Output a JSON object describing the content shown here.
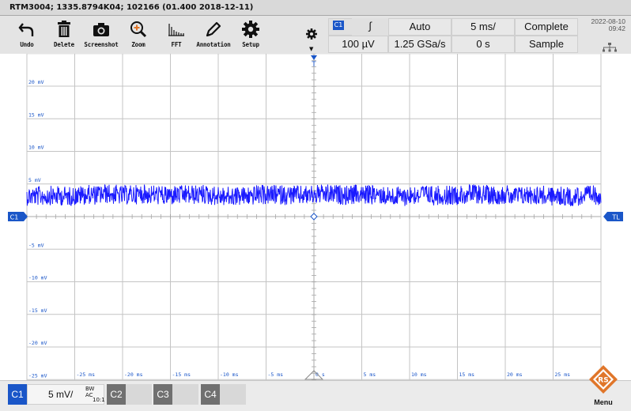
{
  "title": "RTM3004; 1335.8794K04; 102166 (01.400 2018-12-11)",
  "toolbar": {
    "undo": "Undo",
    "delete": "Delete",
    "screenshot": "Screenshot",
    "zoom": "Zoom",
    "fft": "FFT",
    "annotation": "Annotation",
    "setup": "Setup"
  },
  "status": {
    "channel": "C1",
    "slope": "∫",
    "trigger_mode": "Auto",
    "time_scale": "5 ms/",
    "acquisition_state": "Complete",
    "trigger_level": "100 µV",
    "sample_rate": "1.25 GSa/s",
    "trigger_offset": "0 s",
    "acquisition_mode": "Sample",
    "date": "2022-08-10",
    "time": "09:42"
  },
  "markers": {
    "channel_left": "C1",
    "trigger_right": "TL",
    "trigger_top": "T"
  },
  "axes": {
    "y_labels": [
      "20 mV",
      "15 mV",
      "10 mV",
      "5 mV",
      "-5 mV",
      "-10 mV",
      "-15 mV",
      "-20 mV",
      "-25 mV"
    ],
    "x_labels": [
      "-25 ms",
      "-20 ms",
      "-15 ms",
      "-10 ms",
      "-5 ms",
      "0 s",
      "5 ms",
      "10 ms",
      "15 ms",
      "20 ms",
      "25 ms"
    ]
  },
  "footer": {
    "c1": "C1",
    "c1_scale": "5 mV/",
    "c1_coupling": "BW AC",
    "c1_probe": "10:1",
    "c2": "C2",
    "c3": "C3",
    "c4": "C4",
    "menu": "Menu"
  },
  "colors": {
    "trace": "#1a1aff",
    "channel_accent": "#1a56c8",
    "grid": "#c4c4c4",
    "menu_logo": "#e0762a"
  },
  "waveform": {
    "offset_mv": 3.3,
    "noise_pp_mv": 3.0
  }
}
